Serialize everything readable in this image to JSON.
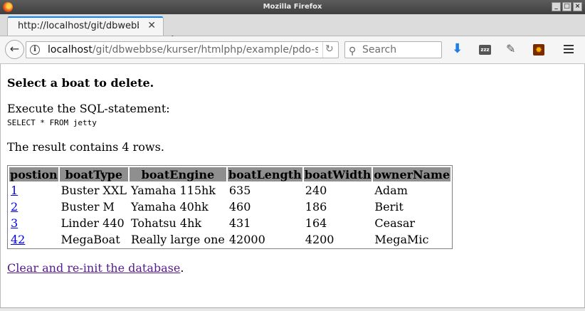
{
  "window": {
    "title": "Mozilla Firefox"
  },
  "tab": {
    "title": "http://localhost/git/dbwebbse/kurser/htmlphp/example/pdo-sqlite"
  },
  "navbar": {
    "url_host": "localhost",
    "url_path": "/git/dbwebbse/kurser/htmlphp/example/pdo-s",
    "url_prefix": "",
    "search_placeholder": "Search"
  },
  "page": {
    "heading": "Select a boat to delete.",
    "exec_label": "Execute the SQL-statement:",
    "sql": "SELECT * FROM jetty",
    "result_text": "The result contains 4 rows.",
    "table": {
      "headers": [
        "postion",
        "boatType",
        "boatEngine",
        "boatLength",
        "boatWidth",
        "ownerName"
      ],
      "rows": [
        [
          "1",
          "Buster XXL",
          "Yamaha 115hk",
          "635",
          "240",
          "Adam"
        ],
        [
          "2",
          "Buster M",
          "Yamaha 40hk",
          "460",
          "186",
          "Berit"
        ],
        [
          "3",
          "Linder 440",
          "Tohatsu 4hk",
          "431",
          "164",
          "Ceasar"
        ],
        [
          "42",
          "MegaBoat",
          "Really large one",
          "42000",
          "4200",
          "MegaMic"
        ]
      ]
    },
    "reinit_link": "Clear and re-init the database",
    "reinit_suffix": "."
  },
  "colors": {
    "link": "#0000ee",
    "visited": "#551a8b",
    "header_bg": "#8f8f8f",
    "tab_accent": "#0a84ff"
  }
}
